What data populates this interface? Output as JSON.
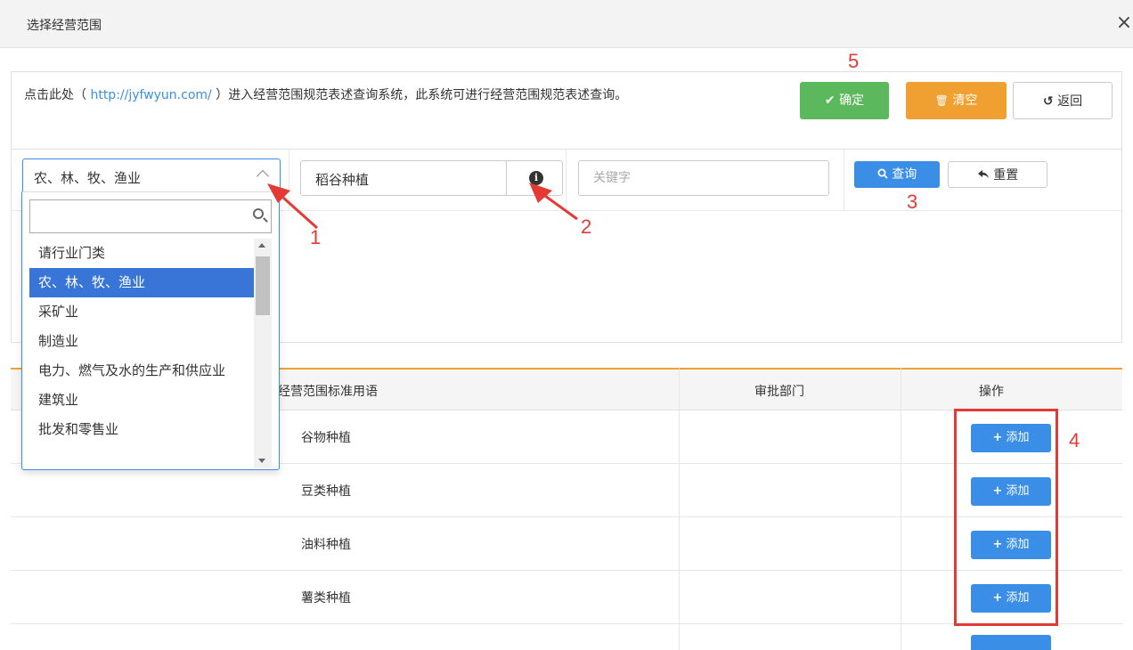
{
  "dialog": {
    "title": "选择经营范围",
    "close_label": "×"
  },
  "notice": {
    "prefix": "点击此处（ ",
    "link_text": "http://jyfwyun.com/",
    "suffix": " ）进入经营范围规范表述查询系统，此系统可进行经营范围规范表述查询。"
  },
  "actions": {
    "confirm_icon": "✔",
    "confirm_label": "确定",
    "clear_icon": "🗑",
    "clear_label": "清空",
    "back_icon": "↺",
    "back_label": "返回"
  },
  "filter": {
    "category_selected": "农、林、牧、渔业",
    "industry_value": "稻谷种植",
    "info_icon": "i",
    "keyword_placeholder": "关键字",
    "query_label": "查询",
    "reset_label": "重置"
  },
  "dropdown": {
    "search_value": "",
    "options": [
      {
        "label": "请行业门类",
        "selected": false
      },
      {
        "label": "农、林、牧、渔业",
        "selected": true
      },
      {
        "label": "采矿业",
        "selected": false
      },
      {
        "label": "制造业",
        "selected": false
      },
      {
        "label": "电力、燃气及水的生产和供应业",
        "selected": false
      },
      {
        "label": "建筑业",
        "selected": false
      },
      {
        "label": "批发和零售业",
        "selected": false
      }
    ]
  },
  "table": {
    "headers": [
      "经营范围标准用语",
      "审批部门",
      "操作"
    ],
    "rows": [
      {
        "term": "谷物种植",
        "dept": "",
        "action": "添加"
      },
      {
        "term": "豆类种植",
        "dept": "",
        "action": "添加"
      },
      {
        "term": "油料种植",
        "dept": "",
        "action": "添加"
      },
      {
        "term": "薯类种植",
        "dept": "",
        "action": "添加"
      }
    ]
  },
  "annotations": {
    "step1": "1",
    "step2": "2",
    "step3": "3",
    "step4": "4",
    "step5": "5",
    "color": "#e53935"
  },
  "colors": {
    "primary": "#3a8ee6",
    "success": "#5cb85c",
    "warning": "#f0a030",
    "selected_option": "#3875d7"
  }
}
